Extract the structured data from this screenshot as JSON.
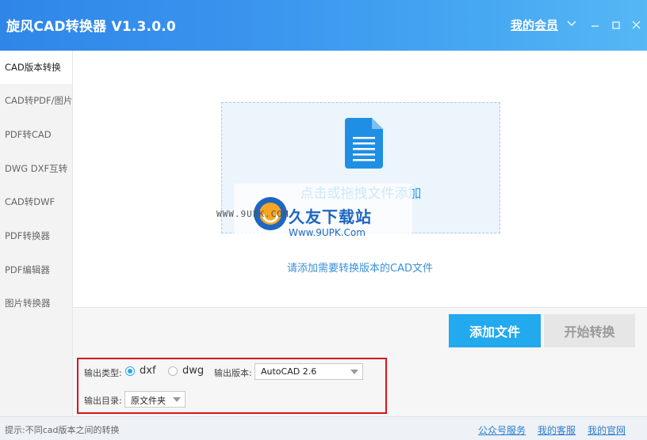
{
  "app": {
    "title": "旋风CAD转换器 V1.3.0.0",
    "member_label": "我的会员"
  },
  "window_controls": [
    "chevron-down-icon",
    "minimize-icon",
    "maximize-icon",
    "close-icon"
  ],
  "sidebar": {
    "items": [
      {
        "label": "CAD版本转换",
        "active": true
      },
      {
        "label": "CAD转PDF/图片",
        "active": false
      },
      {
        "label": "PDF转CAD",
        "active": false
      },
      {
        "label": "DWG DXF互转",
        "active": false
      },
      {
        "label": "CAD转DWF",
        "active": false
      },
      {
        "label": "PDF转换器",
        "active": false
      },
      {
        "label": "PDF编辑器",
        "active": false
      },
      {
        "label": "图片转换器",
        "active": false
      }
    ]
  },
  "dropzone": {
    "icon": "document-icon",
    "text": "点击或拖拽文件添加",
    "hint": "请添加需要转换版本的CAD文件"
  },
  "watermark": {
    "url": "WWW.9UPK.COM",
    "title": "久友下载站",
    "subtitle": "Www.9UPK.Com"
  },
  "actions": {
    "add_file": "添加文件",
    "start_convert": "开始转换"
  },
  "settings": {
    "output_type_label": "输出类型:",
    "type_options": [
      {
        "label": "dxf",
        "checked": true
      },
      {
        "label": "dwg",
        "checked": false
      }
    ],
    "output_version_label": "输出版本:",
    "version_value": "AutoCAD 2.6",
    "output_dir_label": "输出目录:",
    "dir_value": "原文件夹"
  },
  "status": {
    "text": "提示:不同cad版本之间的转换",
    "links": [
      "公众号服务",
      "我的客服",
      "我的官网"
    ]
  },
  "colors": {
    "titlebar_start": "#2f86e8",
    "titlebar_end": "#56b7f5",
    "accent": "#23a9ee",
    "highlight_border": "#d9141d"
  }
}
